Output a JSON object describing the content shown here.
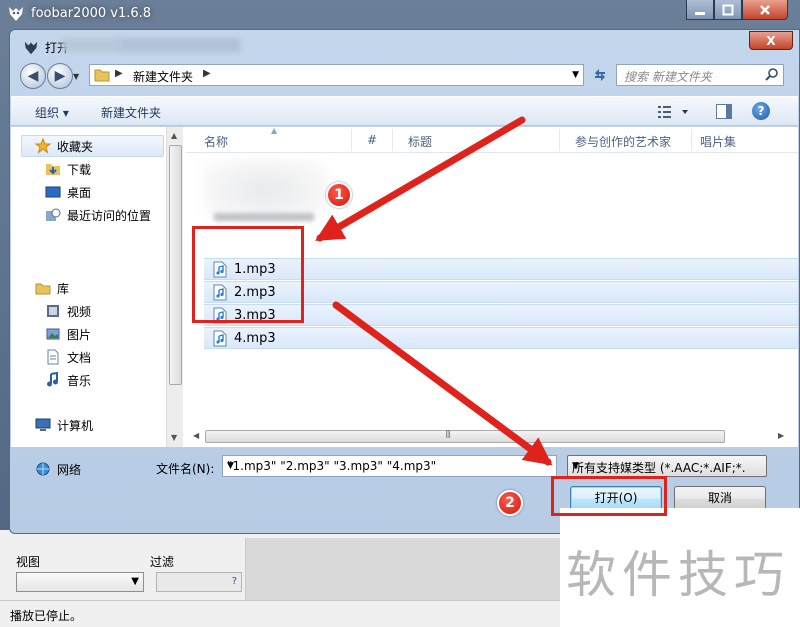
{
  "app": {
    "title": "foobar2000 v1.6.8",
    "status": "播放已停止。",
    "view_label": "视图",
    "filter_label": "过滤",
    "filter_help": "?"
  },
  "dialog": {
    "title": "打开",
    "close_label": "X",
    "address": {
      "crumb": "新建文件夹",
      "search_placeholder": "搜索 新建文件夹"
    },
    "toolbar": {
      "organize": "组织 ▾",
      "new_folder": "新建文件夹",
      "help": "?"
    },
    "nav": {
      "favorites": "收藏夹",
      "downloads": "下载",
      "desktop": "桌面",
      "recent": "最近访问的位置",
      "libraries": "库",
      "videos": "视频",
      "pictures": "图片",
      "documents": "文档",
      "music": "音乐",
      "computer": "计算机",
      "network": "网络"
    },
    "columns": [
      "名称",
      "#",
      "标题",
      "参与创作的艺术家",
      "唱片集"
    ],
    "files": [
      "1.mp3",
      "2.mp3",
      "3.mp3",
      "4.mp3"
    ],
    "filename_label": "文件名(N):",
    "filename_value": "\"1.mp3\" \"2.mp3\" \"3.mp3\" \"4.mp3\"",
    "filetype_value": "所有支持媒类型 (*.AAC;*.AIF;*.",
    "open_button": "打开(O)",
    "cancel_button": "取消"
  },
  "annotations": {
    "step1": "1",
    "step2": "2",
    "accent_red": "#e0221c"
  },
  "watermark": "软件技巧"
}
